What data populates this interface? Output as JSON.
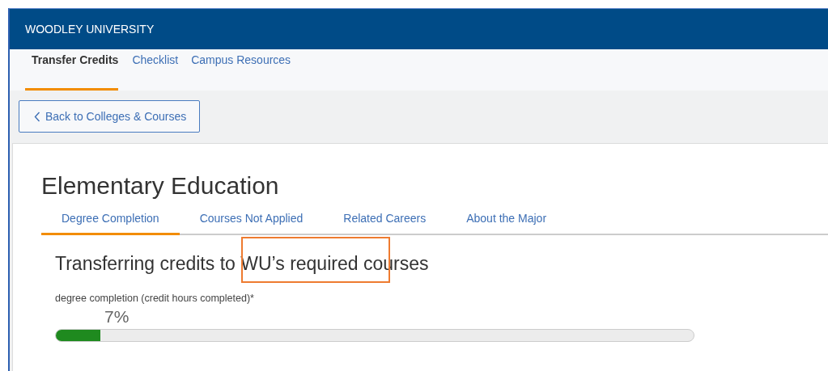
{
  "header": {
    "title": "WOODLEY UNIVERSITY"
  },
  "nav": [
    {
      "label": "Transfer Credits",
      "selected": true
    },
    {
      "label": "Checklist",
      "selected": false
    },
    {
      "label": "Campus Resources",
      "selected": false
    }
  ],
  "back_button": {
    "label": "Back to Colleges & Courses"
  },
  "major": {
    "title": "Elementary Education",
    "tabs": [
      {
        "label": "Degree Completion",
        "selected": true
      },
      {
        "label": "Courses Not Applied",
        "selected": false
      },
      {
        "label": "Related Careers",
        "selected": false
      },
      {
        "label": "About the Major",
        "selected": false
      }
    ],
    "heading": "Transferring credits to WU’s required courses",
    "progress": {
      "label": "degree completion (credit hours completed)*",
      "reading": "7%",
      "level": 0.07
    }
  }
}
